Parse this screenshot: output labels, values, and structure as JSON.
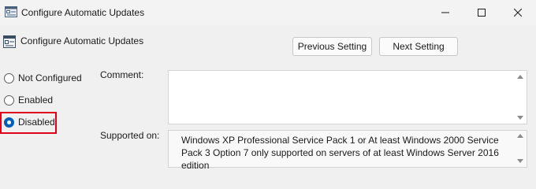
{
  "window": {
    "title": "Configure Automatic Updates",
    "icon": "policy-settings-icon",
    "controls": [
      "minimize-icon",
      "maximize-icon",
      "close-icon"
    ]
  },
  "header": {
    "policy_name": "Configure Automatic Updates",
    "previous_label": "Previous Setting",
    "next_label": "Next Setting"
  },
  "options": [
    {
      "label": "Not Configured",
      "checked": false
    },
    {
      "label": "Enabled",
      "checked": false
    },
    {
      "label": "Disabled",
      "checked": true
    }
  ],
  "fields": {
    "comment_label": "Comment:",
    "comment_value": "",
    "supported_label": "Supported on:",
    "supported_value": "Windows XP Professional Service Pack 1 or At least Windows 2000 Service Pack 3 Option 7 only supported on servers of at least Windows Server 2016 edition"
  },
  "colors": {
    "accent": "#005fb8",
    "highlight": "#e0001b"
  }
}
